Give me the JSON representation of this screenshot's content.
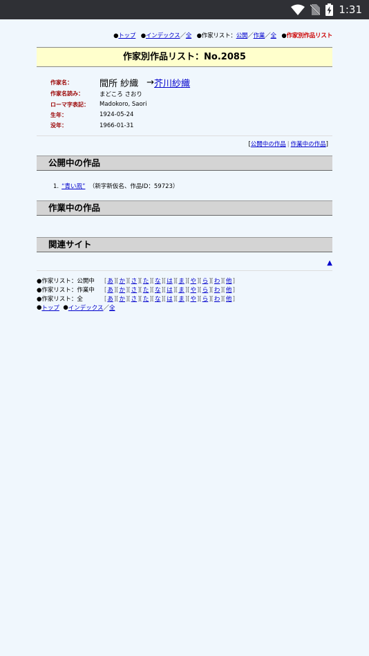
{
  "status_bar": {
    "time": "1:31"
  },
  "top_nav": {
    "top": "トップ",
    "index": "インデックス",
    "all": "全",
    "author_list": "作家リスト：",
    "public": "公開",
    "working": "作業",
    "author_list_all": "全",
    "current": "作家別作品リスト",
    "bullet": "●",
    "slash": "／"
  },
  "title": "作家別作品リスト：No.2085",
  "author": {
    "name_label": "作家名：",
    "name": "間所 紗織",
    "arrow": "→",
    "alias": "芥川紗織",
    "reading_label": "作家名読み：",
    "reading": "まどころ さおり",
    "roman_label": "ローマ字表記：",
    "roman": "Madokoro, Saori",
    "birth_label": "生年：",
    "birth": "1924-05-24",
    "death_label": "没年：",
    "death": "1966-01-31"
  },
  "anchors": {
    "open_l": "[",
    "public_works": "公開中の作品",
    "bar": "|",
    "working_works": "作業中の作品",
    "close_r": "]"
  },
  "sections": {
    "public": "公開中の作品",
    "working": "作業中の作品",
    "related": "関連サイト"
  },
  "works": [
    {
      "num": "1.",
      "title": "“青い凧”",
      "note": "（新字新仮名、作品ID：59723）"
    }
  ],
  "to_top": "▲",
  "footer": {
    "rows": [
      {
        "label": "●作家リスト：公開中"
      },
      {
        "label": "●作家リスト：作業中"
      },
      {
        "label": "●作家リスト：全"
      }
    ],
    "kana": [
      "あ",
      "か",
      "さ",
      "た",
      "な",
      "は",
      "ま",
      "や",
      "ら",
      "わ",
      "他"
    ],
    "bottom": {
      "bullet": "●",
      "top": "トップ",
      "index": "インデックス",
      "slash": "／",
      "all": "全"
    }
  }
}
